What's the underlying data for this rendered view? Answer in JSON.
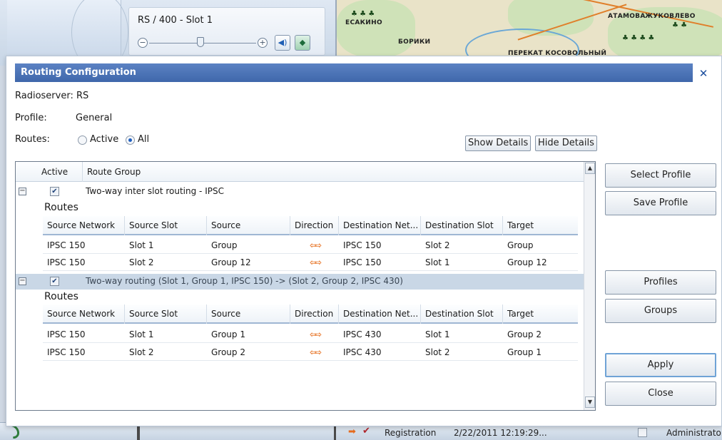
{
  "background": {
    "slot_title": "RS / 400 - Slot 1",
    "map_labels": [
      "ЕСАКИНО",
      "БОРИКИ",
      "ПЕРЕКАТ КОСОВОЛЬНЫЙ",
      "АТАМОВА",
      "ЖУКОВЛЕВО"
    ],
    "status_event": "Registration",
    "status_time": "2/22/2011 12:19:29...",
    "status_user": "Administrator"
  },
  "dialog": {
    "title": "Routing Configuration",
    "radioserver_label": "Radioserver:",
    "radioserver_value": "RS",
    "profile_label": "Profile:",
    "profile_value": "General",
    "routes_label": "Routes:",
    "routes_options": [
      {
        "label": "Active",
        "checked": false
      },
      {
        "label": "All",
        "checked": true
      }
    ],
    "show_details": "Show Details",
    "hide_details": "Hide Details",
    "side_buttons": {
      "select_profile": "Select Profile",
      "save_profile": "Save Profile",
      "profiles": "Profiles",
      "groups": "Groups",
      "apply": "Apply",
      "close": "Close"
    }
  },
  "grid": {
    "columns": [
      "Active",
      "Route Group"
    ],
    "sub_columns": [
      "Source Network",
      "Source Slot",
      "Source",
      "Direction",
      "Destination Net...",
      "Destination Slot",
      "Target"
    ],
    "routes_label": "Routes",
    "groups": [
      {
        "name": "Two-way inter slot routing - IPSC",
        "active": true,
        "expanded": true,
        "routes": [
          {
            "source_network": "IPSC 150",
            "source_slot": "Slot 1",
            "source": "Group",
            "destination_network": "IPSC 150",
            "destination_slot": "Slot 2",
            "target": "Group"
          },
          {
            "source_network": "IPSC 150",
            "source_slot": "Slot 2",
            "source": "Group 12",
            "destination_network": "IPSC 150",
            "destination_slot": "Slot 1",
            "target": "Group 12"
          }
        ]
      },
      {
        "name": "Two-way routing (Slot 1, Group 1, IPSC 150) -> (Slot 2, Group 2, IPSC 430)",
        "active": true,
        "expanded": true,
        "selected": true,
        "routes": [
          {
            "source_network": "IPSC 150",
            "source_slot": "Slot 1",
            "source": "Group 1",
            "destination_network": "IPSC 430",
            "destination_slot": "Slot 1",
            "target": "Group 2"
          },
          {
            "source_network": "IPSC 150",
            "source_slot": "Slot 2",
            "source": "Group 2",
            "destination_network": "IPSC 430",
            "destination_slot": "Slot 2",
            "target": "Group 1"
          }
        ]
      }
    ]
  },
  "icons": {
    "direction": "two-way-arrow-icon",
    "expander": "collapse-minus-icon",
    "close": "close-x-icon"
  },
  "colors": {
    "title_bar": "#4a72b6",
    "selected_row": "#c9d7e6",
    "direction_arrow": "#e8782c"
  }
}
